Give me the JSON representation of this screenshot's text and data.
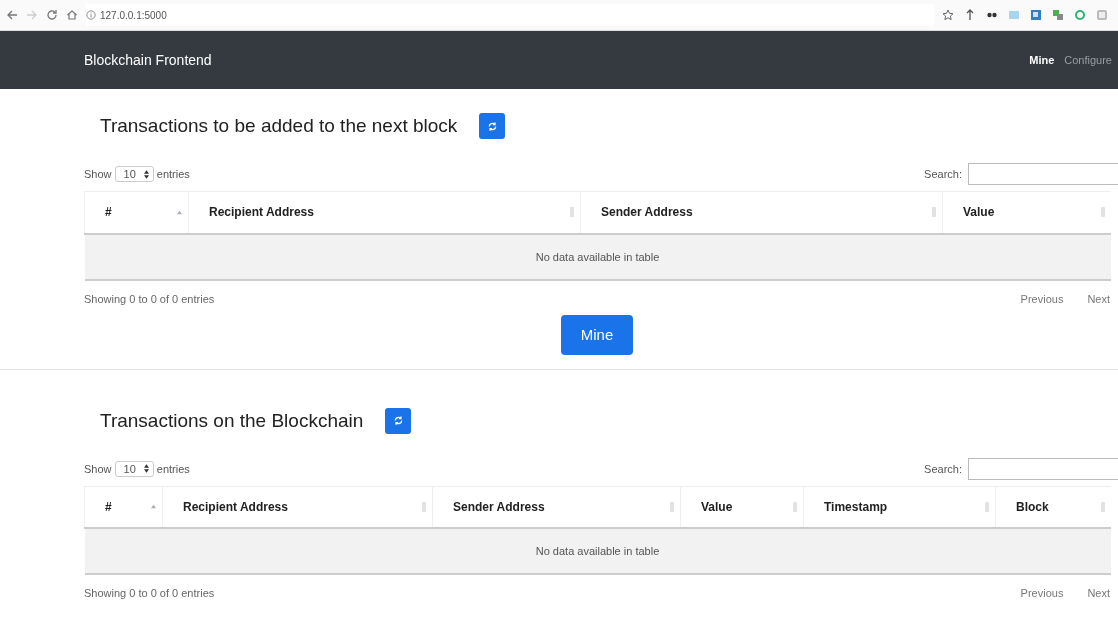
{
  "browser": {
    "url": "127.0.0.1:5000"
  },
  "navbar": {
    "brand": "Blockchain Frontend",
    "items": [
      {
        "label": "Mine",
        "selected": true
      },
      {
        "label": "Configure",
        "selected": false
      }
    ]
  },
  "sections": [
    {
      "title": "Transactions to be added to the next block",
      "show_label": "Show",
      "page_size": "10",
      "entries_label": "entries",
      "search_label": "Search:",
      "columns": [
        {
          "label": "#",
          "sorted": true
        },
        {
          "label": "Recipient Address",
          "sorted": false
        },
        {
          "label": "Sender Address",
          "sorted": false
        },
        {
          "label": "Value",
          "sorted": false
        }
      ],
      "empty_message": "No data available in table",
      "info": "Showing 0 to 0 of 0 entries",
      "previous": "Previous",
      "next": "Next",
      "action_button": "Mine"
    },
    {
      "title": "Transactions on the Blockchain",
      "show_label": "Show",
      "page_size": "10",
      "entries_label": "entries",
      "search_label": "Search:",
      "columns": [
        {
          "label": "#",
          "sorted": true
        },
        {
          "label": "Recipient Address",
          "sorted": false
        },
        {
          "label": "Sender Address",
          "sorted": false
        },
        {
          "label": "Value",
          "sorted": false
        },
        {
          "label": "Timestamp",
          "sorted": false
        },
        {
          "label": "Block",
          "sorted": false
        }
      ],
      "empty_message": "No data available in table",
      "info": "Showing 0 to 0 of 0 entries",
      "previous": "Previous",
      "next": "Next"
    }
  ]
}
